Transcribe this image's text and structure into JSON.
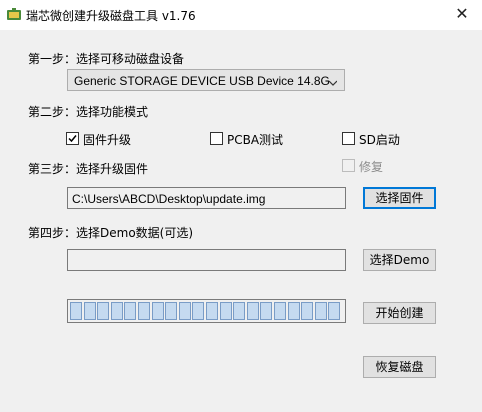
{
  "window": {
    "title": "瑞芯微创建升级磁盘工具 v1.76",
    "close_glyph": "✕",
    "icon": "app-icon"
  },
  "step1": {
    "label": "第一步：选择可移动磁盘设备",
    "device_select_value": "Generic STORAGE DEVICE USB Device   14.8G"
  },
  "step2": {
    "label": "第二步：选择功能模式",
    "options": [
      {
        "label": "固件升级",
        "checked": true
      },
      {
        "label": "PCBA测试",
        "checked": false
      },
      {
        "label": "SD启动",
        "checked": false
      }
    ]
  },
  "step3": {
    "label": "第三步：选择升级固件",
    "restore_option": {
      "label": "修复",
      "checked": false,
      "disabled": true
    },
    "firmware_path": "C:\\Users\\ABCD\\Desktop\\update.img",
    "select_button": "选择固件"
  },
  "step4": {
    "label": "第四步：选择Demo数据(可选)",
    "demo_path": "",
    "select_button": "选择Demo"
  },
  "progress": {
    "segments": 20,
    "fraction": 0
  },
  "actions": {
    "start_button": "开始创建",
    "restore_button": "恢复磁盘"
  },
  "colors": {
    "window_bg": "#f0f0f0",
    "focus_border": "#0078d7",
    "progress_segment": "#c5daf0"
  }
}
